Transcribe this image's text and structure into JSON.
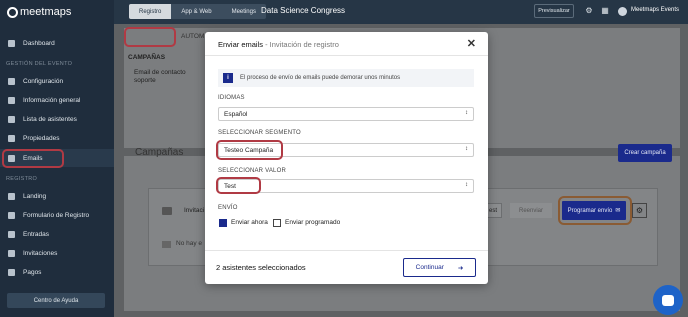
{
  "brand": {
    "logo_text": "meetmaps"
  },
  "topbar": {
    "tabs": [
      "Registro",
      "App & Web",
      "Meetings"
    ],
    "event_title": "Data Science Congress",
    "preview_label": "Previsualizar",
    "user_name": "Meetmaps Events"
  },
  "sidebar": {
    "dashboard": "Dashboard",
    "section_event": "GESTIÓN DEL EVENTO",
    "event_items": [
      "Configuración",
      "Información general",
      "Lista de asistentes",
      "Propiedades",
      "Emails"
    ],
    "section_registro": "REGISTRO",
    "registro_items": [
      "Landing",
      "Formulario de Registro",
      "Entradas",
      "Invitaciones",
      "Pagos"
    ],
    "help_label": "Centro de Ayuda"
  },
  "page": {
    "tab_campaigns": "CAMPAÑAS",
    "tab_auto": "AUTOM",
    "support_email_label": "Email de contacto soporte",
    "campaigns_title": "Campañas",
    "create_campaign": "Crear campaña",
    "invitation_label": "Invitaci",
    "test_label": "est",
    "resend_label": "Reenviar",
    "schedule_label": "Programar envío",
    "empty_label": "No hay e"
  },
  "modal": {
    "title": "Enviar emails",
    "subtitle": " - Invitación de registro",
    "info": "El proceso de envío de emails puede demorar unos minutos",
    "language_label": "IDIOMAS",
    "language_value": "Español",
    "segment_label": "SELECCIONAR SEGMENTO",
    "segment_value": "Testeo Campaña",
    "value_label": "SELECCIONAR VALOR",
    "value_value": "Test",
    "send_label": "ENVÍO",
    "send_now": "Enviar ahora",
    "send_scheduled": "Enviar programado",
    "selected_count": "2 asistentes seleccionados",
    "continue_label": "Continuar"
  },
  "colors": {
    "primary": "#1a2a8c",
    "sidebar": "#1f2d3d",
    "highlight": "#b03a44"
  }
}
